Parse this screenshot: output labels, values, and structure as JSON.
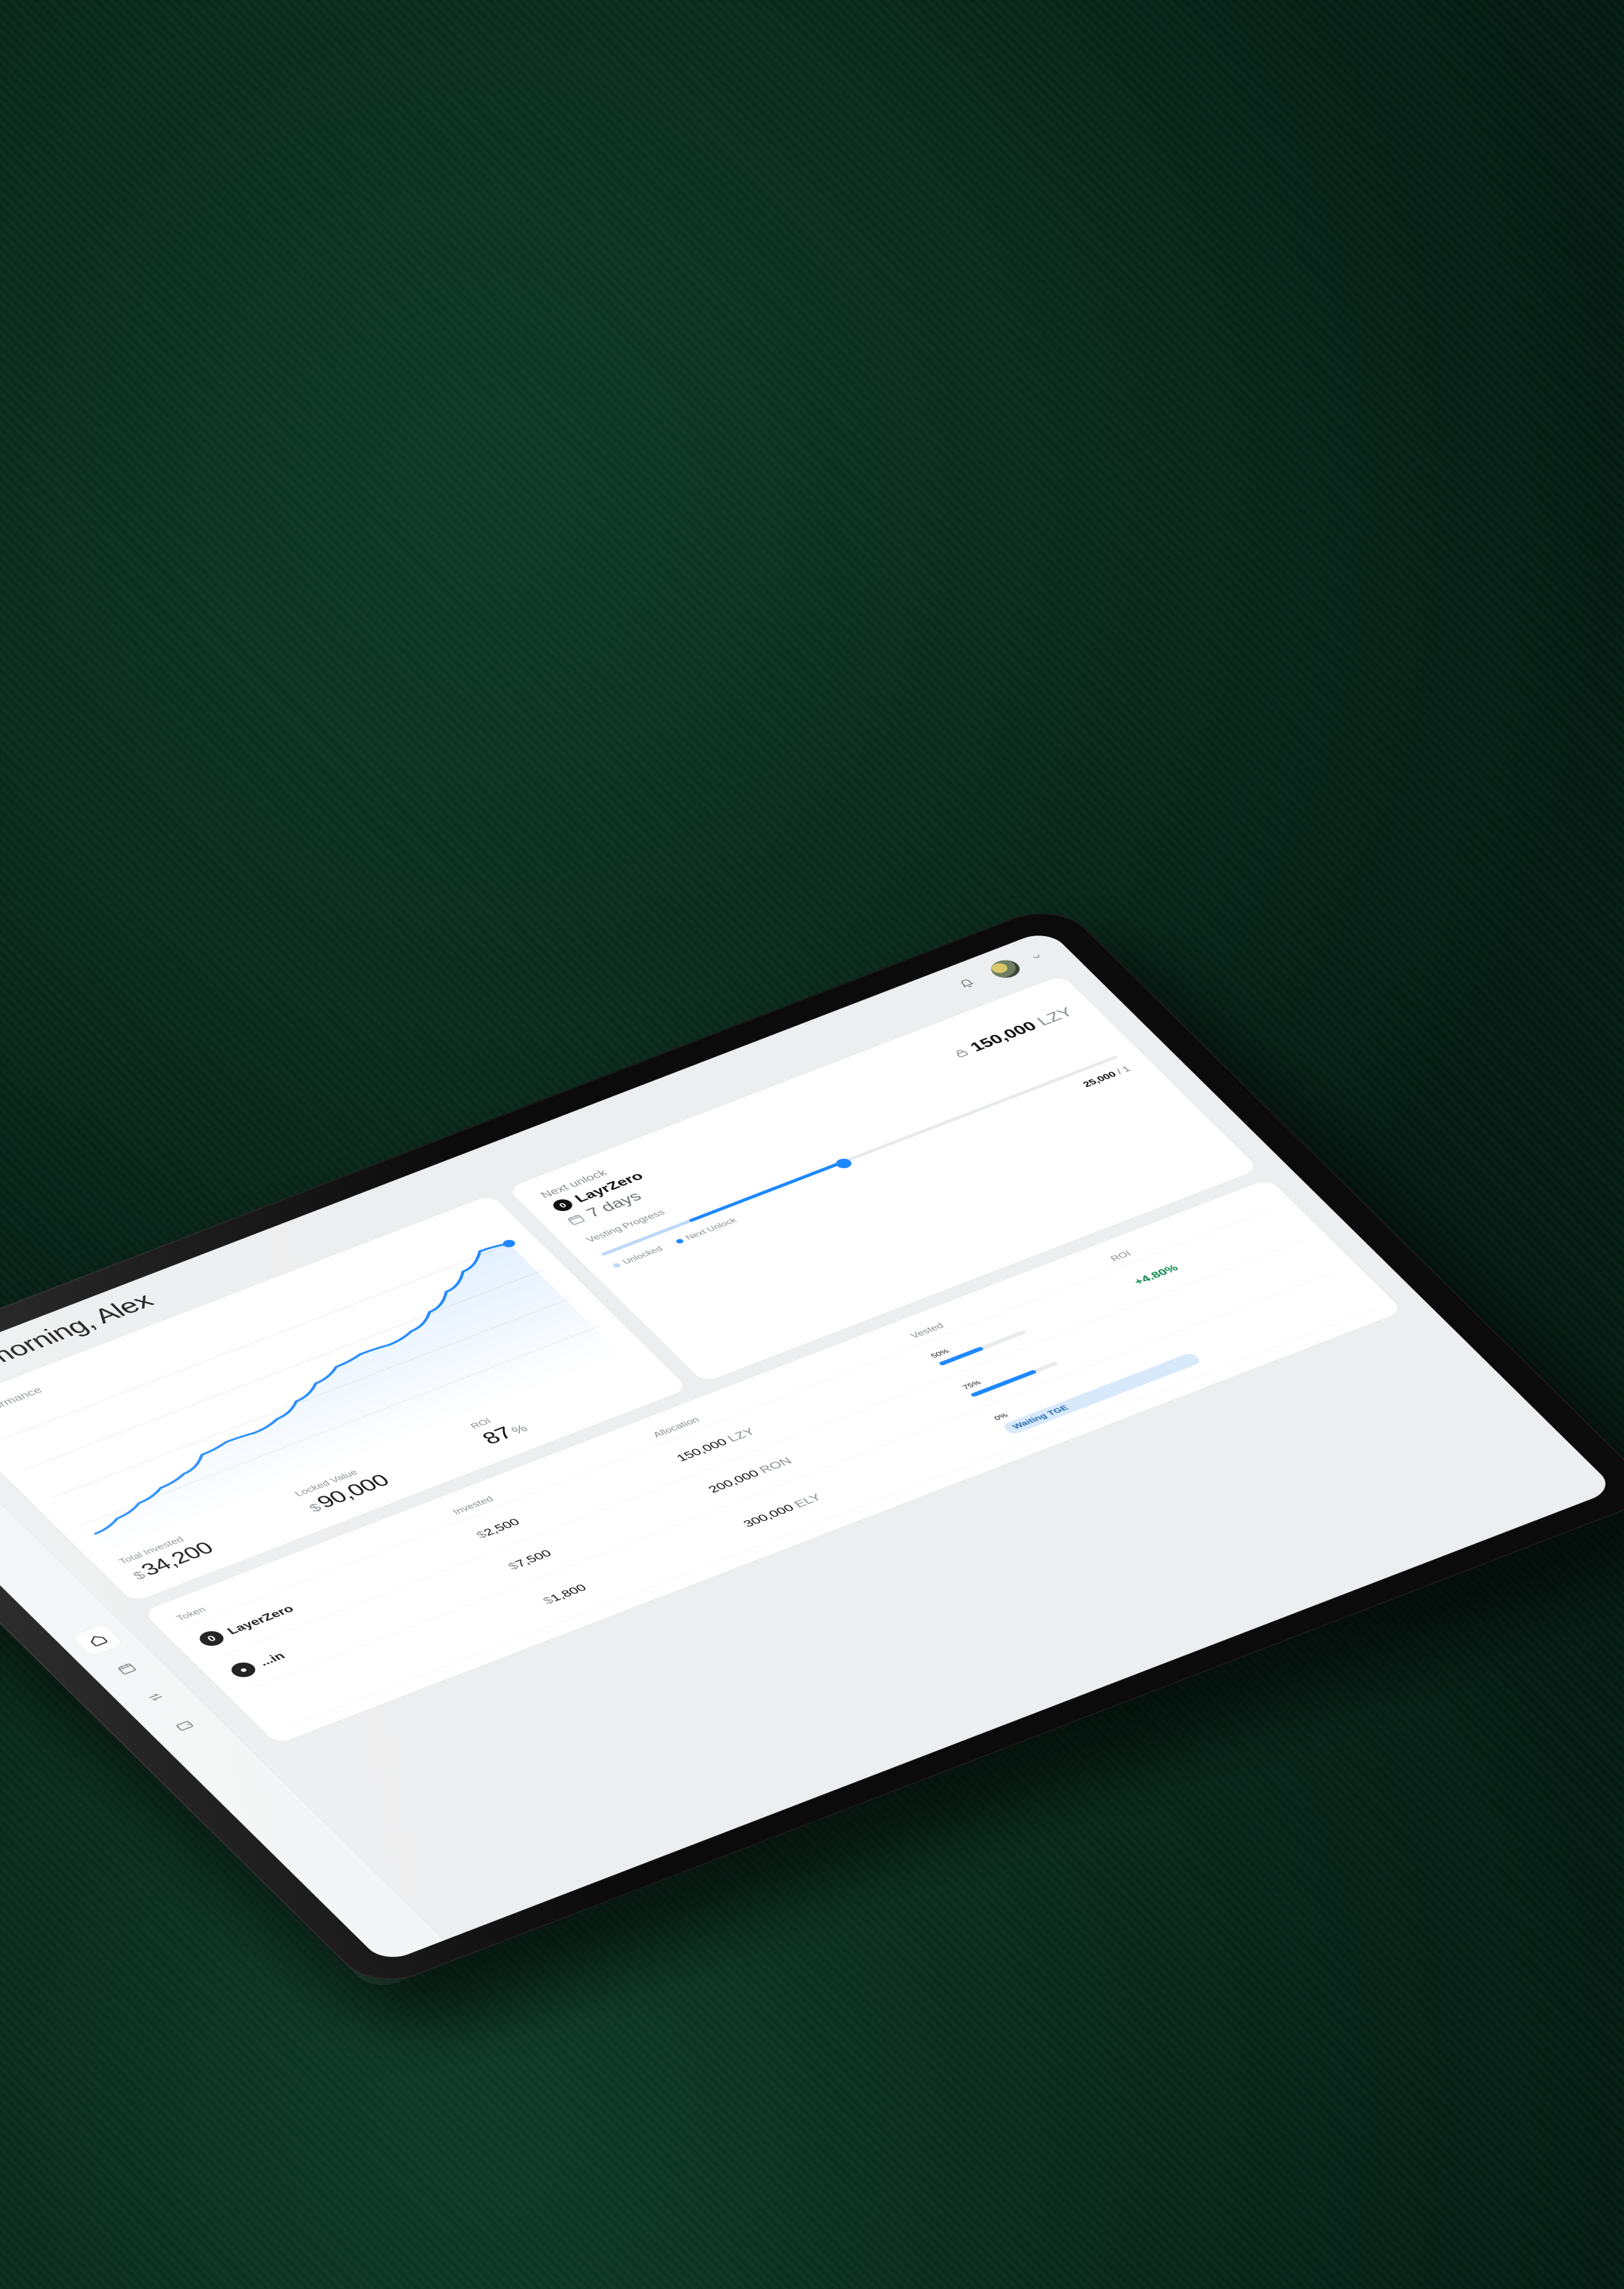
{
  "greeting": "Good morning, Alex",
  "sidebar": {
    "logo_glyph": "⏩",
    "items": [
      {
        "id": "home",
        "active": true
      },
      {
        "id": "calendar",
        "active": false
      },
      {
        "id": "transfer",
        "active": false
      },
      {
        "id": "wallet",
        "active": false
      }
    ]
  },
  "performance": {
    "title": "Performance",
    "stats": [
      {
        "label": "Total Invested",
        "currency": "$",
        "value": "34,200"
      },
      {
        "label": "Locked Value",
        "currency": "$",
        "value": "90,000"
      },
      {
        "label": "ROI",
        "value": "87",
        "suffix": "%"
      }
    ]
  },
  "next_unlock": {
    "title": "Next unlock",
    "token_name": "LayrZero",
    "days_label": "7 days",
    "amount_value": "150,000",
    "amount_ticker": "LZY",
    "vesting_title": "Vesting Progress",
    "unlocked_pct": 17,
    "next_pct_end": 47,
    "legend_unlocked": "Unlocked",
    "legend_next": "Next Unlock",
    "progress_current": "25,000",
    "progress_total_prefix": "/ 1"
  },
  "table": {
    "headers": [
      "Token",
      "Invested",
      "Allocation",
      "Vested",
      "ROI"
    ],
    "rows": [
      {
        "token": "LayerZero",
        "icon_glyph": "0",
        "invested_currency": "$",
        "invested_value": "2,500",
        "allocation_value": "150,000",
        "allocation_ticker": "LZY",
        "vested_pct": 50,
        "vested_label": "50%",
        "roi": "+4.80%"
      },
      {
        "token": "...in",
        "icon_glyph": "●",
        "invested_currency": "$",
        "invested_value": "7,500",
        "allocation_value": "200,000",
        "allocation_ticker": "RON",
        "vested_pct": 75,
        "vested_label": "75%",
        "roi": ""
      },
      {
        "token": "",
        "icon_glyph": "",
        "invested_currency": "$",
        "invested_value": "1,800",
        "allocation_value": "300,000",
        "allocation_ticker": "ELY",
        "vested_pct": 0,
        "vested_label": "0%",
        "badge": "Waiting TGE",
        "roi": ""
      }
    ]
  },
  "chart_data": {
    "type": "line",
    "title": "Performance",
    "x": [
      0,
      1,
      2,
      3,
      4,
      5,
      6,
      7,
      8,
      9,
      10,
      11,
      12,
      13,
      14,
      15,
      16,
      17,
      18,
      19
    ],
    "values": [
      12,
      16,
      20,
      24,
      27,
      34,
      36,
      35,
      38,
      44,
      50,
      55,
      57,
      56,
      59,
      66,
      74,
      82,
      90,
      88
    ],
    "ylim": [
      0,
      100
    ],
    "end_marker": true
  }
}
